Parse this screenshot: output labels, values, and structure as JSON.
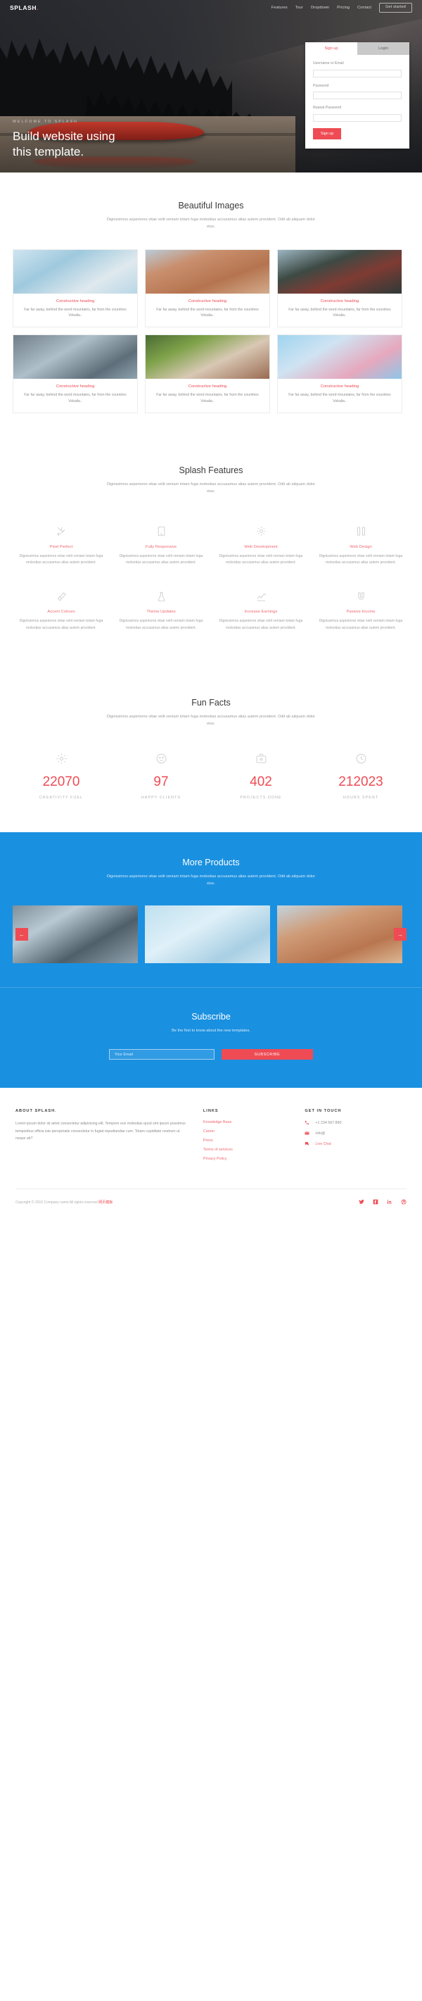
{
  "nav": {
    "brand": "SPLASH",
    "brand_dot": ".",
    "links": [
      {
        "label": "Features"
      },
      {
        "label": "Tour"
      },
      {
        "label": "Dropdown"
      },
      {
        "label": "Pricing"
      },
      {
        "label": "Contact"
      }
    ],
    "cta": "Get started"
  },
  "hero": {
    "eyebrow": "WELCOME TO SPLASH",
    "title_line1": "Build website using",
    "title_line2": "this template."
  },
  "auth": {
    "tab_signup": "Sign up",
    "tab_login": "Login",
    "label_username": "Username or Email",
    "label_password": "Password",
    "label_repeat": "Repeat Password",
    "value_username": "",
    "value_password": "",
    "value_repeat": "",
    "submit": "Sign up"
  },
  "images_section": {
    "title": "Beautiful Images",
    "subtitle": "Dignissimos asperiores vitae velit veniam totam fuga molestias accusamus alias autem provident. Odit ab aliquam dolor eius.",
    "cards": [
      {
        "title": "Constructive heading",
        "text": "Far far away, behind the word mountains, far from the countries Vokalia.."
      },
      {
        "title": "Constructive heading",
        "text": "Far far away, behind the word mountains, far from the countries Vokalia.."
      },
      {
        "title": "Constructive heading",
        "text": "Far far away, behind the word mountains, far from the countries Vokalia.."
      },
      {
        "title": "Constructive heading",
        "text": "Far far away, behind the word mountains, far from the countries Vokalia.."
      },
      {
        "title": "Constructive heading",
        "text": "Far far away, behind the word mountains, far from the countries Vokalia.."
      },
      {
        "title": "Constructive heading",
        "text": "Far far away, behind the word mountains, far from the countries Vokalia.."
      }
    ]
  },
  "features_section": {
    "title": "Splash Features",
    "subtitle": "Dignissimos asperiores vitae velit veniam totam fuga molestias accusamus alias autem provident. Odit ab aliquam dolor eius.",
    "items": [
      {
        "title": "Pixel Perfect",
        "text": "Dignissimos asperiores vitae velit veniam totam fuga molestias accusamus alias autem provident.",
        "icon": "tools-icon"
      },
      {
        "title": "Fully Responsive",
        "text": "Dignissimos asperiores vitae velit veniam totam fuga molestias accusamus alias autem provident.",
        "icon": "tablet-icon"
      },
      {
        "title": "Web Development",
        "text": "Dignissimos asperiores vitae velit veniam totam fuga molestias accusamus alias autem provident.",
        "icon": "gear-icon"
      },
      {
        "title": "Web Design",
        "text": "Dignissimos asperiores vitae velit veniam totam fuga molestias accusamus alias autem provident.",
        "icon": "columns-icon"
      },
      {
        "title": "Accent Colours",
        "text": "Dignissimos asperiores vitae velit veniam totam fuga molestias accusamus alias autem provident.",
        "icon": "brush-icon"
      },
      {
        "title": "Theme Updates",
        "text": "Dignissimos asperiores vitae velit veniam totam fuga molestias accusamus alias autem provident.",
        "icon": "flask-icon"
      },
      {
        "title": "Increase Earnings",
        "text": "Dignissimos asperiores vitae velit veniam totam fuga molestias accusamus alias autem provident.",
        "icon": "chart-up-icon"
      },
      {
        "title": "Passive Income",
        "text": "Dignissimos asperiores vitae velit veniam totam fuga molestias accusamus alias autem provident.",
        "icon": "magnet-icon"
      }
    ]
  },
  "facts_section": {
    "title": "Fun Facts",
    "subtitle": "Dignissimos asperiores vitae velit veniam totam fuga molestias accusamus alias autem provident. Odit ab aliquam dolor eius.",
    "items": [
      {
        "number": "22070",
        "label": "CREATIVITY FUEL",
        "icon": "gear-icon"
      },
      {
        "number": "97",
        "label": "HAPPY CLIENTS",
        "icon": "smiley-icon"
      },
      {
        "number": "402",
        "label": "PROJECTS DONE",
        "icon": "briefcase-icon"
      },
      {
        "number": "212023",
        "label": "HOURS SPENT",
        "icon": "clock-icon"
      }
    ]
  },
  "products_section": {
    "title": "More Products",
    "subtitle": "Dignissimos asperiores vitae velit veniam totam fuga molestias accusamus alias autem provident. Odit ab aliquam dolor eius.",
    "prev_arrow": "←",
    "next_arrow": "→"
  },
  "subscribe_section": {
    "title": "Subscribe",
    "subtitle": "Be the first to know about the new templates.",
    "input_placeholder": "Your Email",
    "input_value": "",
    "button": "SUBSCRIBE"
  },
  "footer": {
    "about_heading": "ABOUT SPLASH",
    "about_heading_dot": ".",
    "about_text": "Lorem ipsum dolor sit amet consectetur adipisicing elit. Tempore eos molestias quod sint ipsum possimus temporibus officia iste perspiciatis consectetur in fugiat repudiandae cum. Totam cupiditate nostrum ut neque ab?",
    "links_heading": "LINKS",
    "links": [
      {
        "label": "Knowledge Base"
      },
      {
        "label": "Career"
      },
      {
        "label": "Press"
      },
      {
        "label": "Terms of services"
      },
      {
        "label": "Privacy Policy"
      }
    ],
    "touch_heading": "GET IN TOUCH",
    "touch": [
      {
        "icon": "phone-icon",
        "text": "+1 234 567 890",
        "is_link": false
      },
      {
        "icon": "mail-icon",
        "text": "info@",
        "is_link": false
      },
      {
        "icon": "chat-icon",
        "text": "Live Chat",
        "is_link": true
      }
    ],
    "copyright": "Copyright © 2016 Company name All rights reserved ",
    "copyright_cn": "网页模板",
    "socials": [
      {
        "name": "twitter-icon"
      },
      {
        "name": "facebook-icon"
      },
      {
        "name": "linkedin-icon"
      },
      {
        "name": "dribbble-icon"
      }
    ]
  },
  "colors": {
    "accent_red": "#ef4b54",
    "accent_blue": "#1a90e0",
    "dark": "#3a3a3a"
  }
}
